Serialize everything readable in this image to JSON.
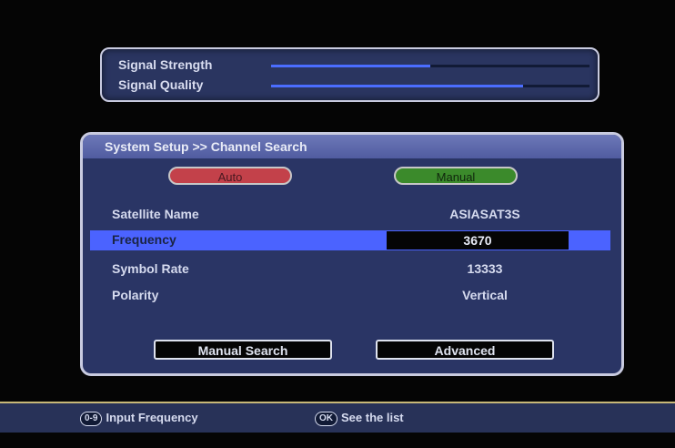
{
  "signal": {
    "strength_label": "Signal Strength",
    "strength_level": 0.5,
    "quality_label": "Signal Quality",
    "quality_level": 0.79
  },
  "panel": {
    "title": "System Setup >> Channel Search",
    "mode_auto": "Auto",
    "mode_manual": "Manual",
    "rows": [
      {
        "label": "Satellite Name",
        "value": "ASIASAT3S"
      },
      {
        "label": "Frequency",
        "value": "3670"
      },
      {
        "label": "Symbol Rate",
        "value": "13333"
      },
      {
        "label": "Polarity",
        "value": "Vertical"
      }
    ],
    "manual_search": "Manual Search",
    "advanced": "Advanced"
  },
  "footer": {
    "key1": "0-9",
    "hint1": "Input Frequency",
    "key2": "OK",
    "hint2": "See the list"
  },
  "colors": {
    "accent": "#4b63ff",
    "auto_button": "#c3414a",
    "manual_button": "#3b8a2b"
  }
}
